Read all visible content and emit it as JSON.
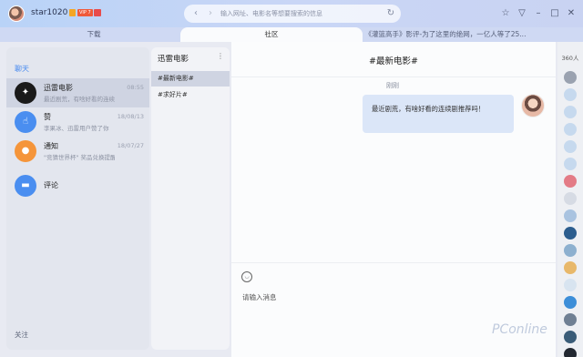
{
  "topbar": {
    "username": "star1020",
    "vip_label": "VIP 7",
    "url_placeholder": "输入网址、电影名等想要搜索的信息",
    "back_icon": "chevron-left-icon",
    "forward_icon": "chevron-right-icon",
    "refresh_icon": "refresh-icon",
    "buttons": [
      "skin-icon",
      "dropdown-icon",
      "minimize-icon",
      "maximize-icon",
      "close-icon"
    ]
  },
  "tabs": [
    {
      "label": "下载"
    },
    {
      "label": "社区"
    },
    {
      "label": "《灌篮高手》影评-为了这里的绝网，一亿人等了25..."
    }
  ],
  "left": {
    "section_title": "聊天",
    "conversations": [
      {
        "name": "迅雷电影",
        "preview": "最近剧荒，有啥好看的连续剧推荐",
        "time": "08:55",
        "color": "#1a1a1a"
      },
      {
        "name": "赞",
        "preview": "李果冰、迅雷用户赞了你",
        "time": "18/08/13",
        "color": "#4a8ef0"
      },
      {
        "name": "通知",
        "preview": "\"竞猜世界杯\" 奖品兑换提醒",
        "time": "18/07/27",
        "color": "#f5953a"
      },
      {
        "name": "评论",
        "preview": "",
        "time": "",
        "color": "#4a8ef0"
      }
    ],
    "follow": "关注"
  },
  "middle": {
    "title": "迅雷电影",
    "more": "⋮",
    "items": [
      {
        "label": "#最新电影#"
      },
      {
        "label": "#求好片#"
      }
    ]
  },
  "chat": {
    "title": "#最新电影#",
    "time": "刚刚",
    "message": "最近剧荒，有啥好看的连续剧推荐吗！",
    "input_placeholder": "请输入消息"
  },
  "members": {
    "count": "360人",
    "avatar_colors": [
      "#9aa2b0",
      "#c6d9ee",
      "#c6d9ee",
      "#c6d9ee",
      "#c6d9ee",
      "#c6d9ee",
      "#e37b86",
      "#d6dbe4",
      "#a9c3e0",
      "#2c5d8e",
      "#8db0cf",
      "#e8b86a",
      "#d8e4f0",
      "#3d8ed8",
      "#6f7f93",
      "#3a5c78",
      "#222831"
    ]
  },
  "watermark": "PConline"
}
